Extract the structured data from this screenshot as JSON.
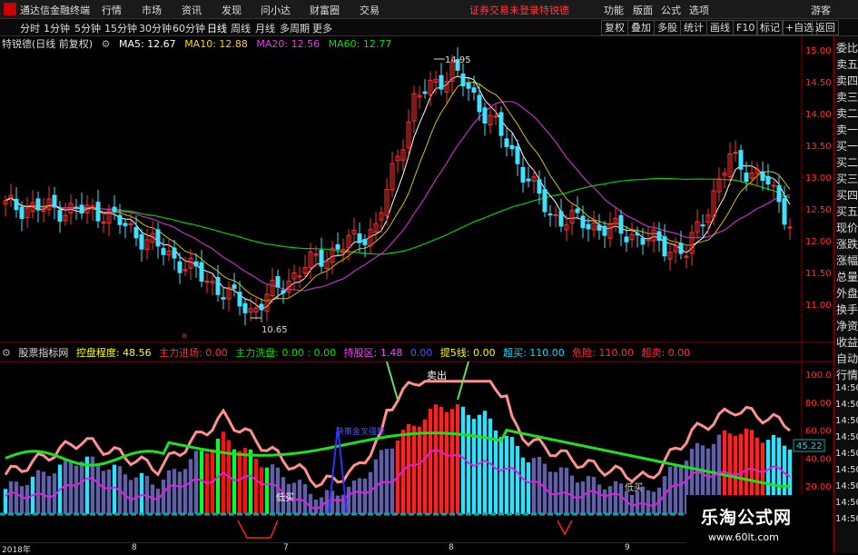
{
  "menubar": {
    "app_name": "通达信金融终端",
    "items": [
      "行情",
      "市场",
      "资讯",
      "发现",
      "问小达",
      "财富圈",
      "交易"
    ],
    "warning": "证券交易未登录",
    "warning_stock": "特锐德",
    "right_items": [
      "功能",
      "版面",
      "公式",
      "选项"
    ],
    "guest": "游客"
  },
  "periods": {
    "items": [
      "分时",
      "1分钟",
      "5分钟",
      "15分钟",
      "30分钟",
      "60分钟",
      "日线",
      "周线",
      "月线",
      "多周期",
      "更多"
    ],
    "active": "日线",
    "right_buttons": [
      "复权",
      "叠加",
      "多股",
      "统计",
      "画线",
      "F10",
      "标记",
      "+自选",
      "返回"
    ]
  },
  "ma_line": {
    "title": "特锐德(日线 前复权)",
    "ma5_label": "MA5: 12.67",
    "ma10_label": "MA10: 12.88",
    "ma20_label": "MA20: 12.56",
    "ma60_label": "MA60: 12.77",
    "colors": {
      "ma5": "#ffffff",
      "ma10": "#ffd400",
      "ma20": "#e040e0",
      "ma60": "#00e000"
    }
  },
  "price_axis": {
    "ticks": [
      "15.00",
      "14.50",
      "14.00",
      "13.50",
      "13.00",
      "12.50",
      "12.00",
      "11.50",
      "11.00"
    ],
    "annotations": {
      "high": "14.95",
      "low": "10.65"
    }
  },
  "indicator": {
    "name": "股票指标网",
    "items": [
      {
        "label": "控盘程度: 48.56",
        "color": "#ffff00"
      },
      {
        "label": "主力进场: 0.00",
        "color": "#ff3030"
      },
      {
        "label": "主力洗盘: 0.00 : 0.00",
        "color": "#00e000"
      },
      {
        "label": "持股区: 1.48",
        "color": "#ff40ff"
      },
      {
        "label": "0.00",
        "color": "#5050ff"
      },
      {
        "label": "提5线: 0.00",
        "color": "#ffff00"
      },
      {
        "label": "超买: 110.00",
        "color": "#00e0ff"
      },
      {
        "label": "危险: 110.00",
        "color": "#ff3030"
      },
      {
        "label": "超卖: 0.00",
        "color": "#ff3030"
      }
    ],
    "axis_ticks": [
      "100.0",
      "80.00",
      "60.00",
      "40.00",
      "20.00"
    ],
    "current_value": "45.22",
    "labels": {
      "sell": "卖出",
      "low_buy": "低买",
      "low_buy2": "低买",
      "bull": "决策金叉强势"
    }
  },
  "right_panel": {
    "items": [
      "委比",
      "卖五",
      "卖四",
      "卖三",
      "卖二",
      "卖一",
      "买一",
      "买二",
      "买三",
      "买四",
      "买五",
      "现价",
      "涨跌",
      "涨幅",
      "总量",
      "外盘",
      "换手",
      "净资",
      "收益",
      "自动",
      "行情",
      "14:50",
      "14:50",
      "14:50",
      "14:50",
      "14:50",
      "14:50",
      "14:50",
      "14:50",
      "14:50"
    ]
  },
  "date_axis": {
    "labels": [
      "2018年",
      "8",
      "7",
      "8",
      "9"
    ]
  },
  "watermark": {
    "title": "乐淘公式网",
    "url": "www.60lt.com"
  }
}
